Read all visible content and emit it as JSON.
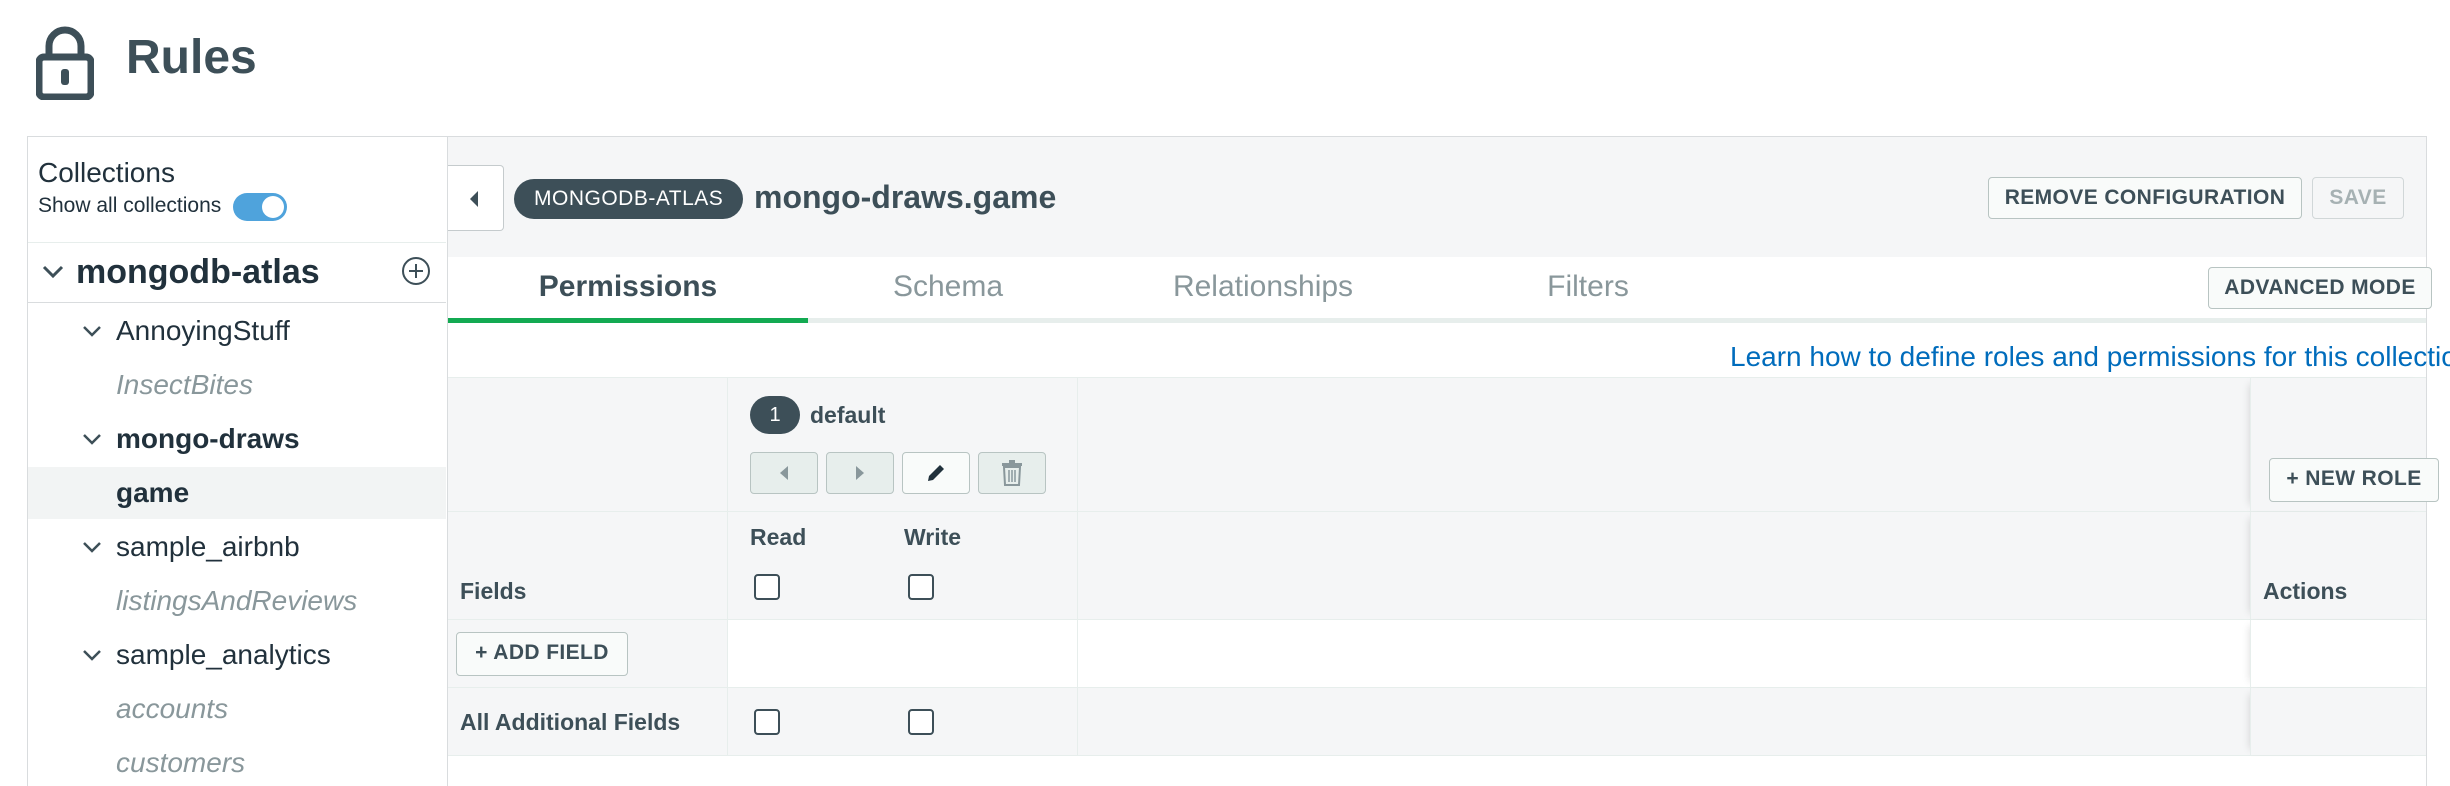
{
  "header": {
    "title": "Rules",
    "icon": "lock-icon"
  },
  "sidebar": {
    "collections_label": "Collections",
    "show_all_label": "Show all collections",
    "show_all_enabled": true,
    "cluster": {
      "name": "mongodb-atlas"
    },
    "databases": [
      {
        "name": "AnnoyingStuff",
        "collections": [
          "InsectBites"
        ]
      },
      {
        "name": "mongo-draws",
        "collections": [
          "game"
        ]
      },
      {
        "name": "sample_airbnb",
        "collections": [
          "listingsAndReviews"
        ]
      },
      {
        "name": "sample_analytics",
        "collections": [
          "accounts",
          "customers"
        ]
      }
    ],
    "selected_collection": "game"
  },
  "topbar": {
    "service_badge": "MONGODB-ATLAS",
    "collection_title": "mongo-draws.game",
    "remove_label": "REMOVE CONFIGURATION",
    "save_label": "SAVE"
  },
  "tabs": [
    {
      "label": "Permissions",
      "active": true
    },
    {
      "label": "Schema",
      "active": false
    },
    {
      "label": "Relationships",
      "active": false
    },
    {
      "label": "Filters",
      "active": false
    }
  ],
  "advanced_mode_label": "ADVANCED MODE",
  "learn_link": "Learn how to define roles and permissions for this collection.",
  "roles": {
    "items": [
      {
        "index": "1",
        "name": "default"
      }
    ],
    "new_role_label": "+ NEW ROLE"
  },
  "permissions_table": {
    "fields_label": "Fields",
    "read_label": "Read",
    "write_label": "Write",
    "actions_label": "Actions",
    "add_field_label": "+ ADD FIELD",
    "additional_fields_label": "All Additional Fields",
    "read_checked": false,
    "write_checked": false,
    "additional_read_checked": false,
    "additional_write_checked": false
  },
  "colors": {
    "accent_green": "#13aa52",
    "toggle_blue": "#4fa3dc",
    "link_blue": "#006cbc",
    "badge_dark": "#3d4f58"
  }
}
